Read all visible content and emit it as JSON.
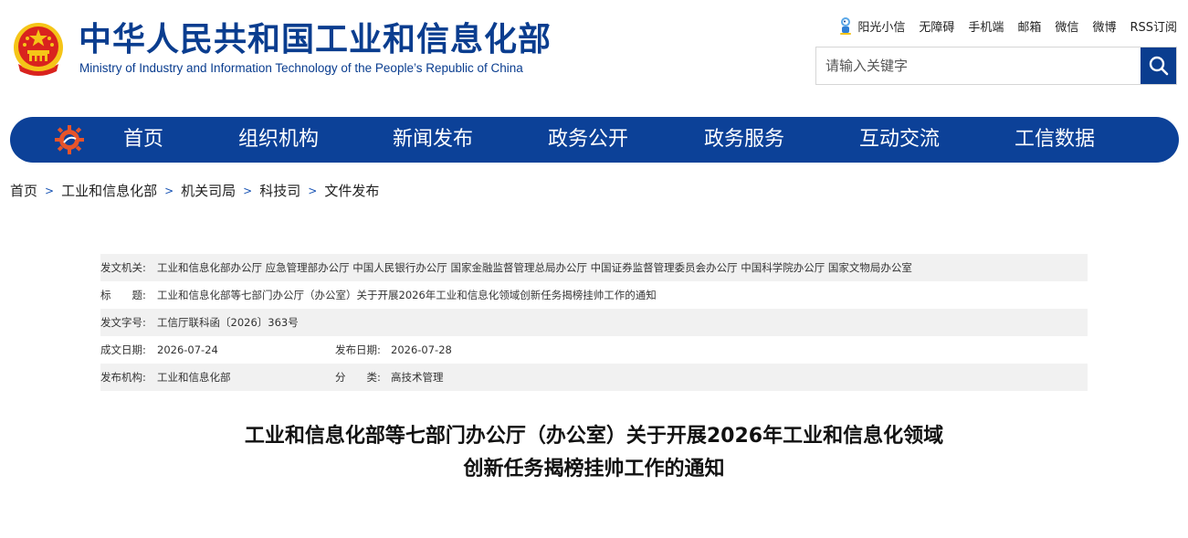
{
  "header": {
    "title_cn": "中华人民共和国工业和信息化部",
    "title_en": "Ministry of Industry and Information Technology of the People’s Republic of China",
    "links": [
      {
        "label": "阳光小信",
        "icon": "mascot-icon"
      },
      {
        "label": "无障碍"
      },
      {
        "label": "手机端"
      },
      {
        "label": "邮箱"
      },
      {
        "label": "微信"
      },
      {
        "label": "微博"
      },
      {
        "label": "RSS订阅"
      }
    ],
    "search": {
      "placeholder": "请输入关键字",
      "value": ""
    }
  },
  "nav": {
    "items": [
      "首页",
      "组织机构",
      "新闻发布",
      "政务公开",
      "政务服务",
      "互动交流",
      "工信数据"
    ]
  },
  "breadcrumb": [
    "首页",
    "工业和信息化部",
    "机关司局",
    "科技司",
    "文件发布"
  ],
  "info": {
    "issuer_label": "发文机关:",
    "issuer_value": "工业和信息化部办公厅 应急管理部办公厅 中国人民银行办公厅 国家金融监督管理总局办公厅 中国证券监督管理委员会办公厅 中国科学院办公厅 国家文物局办公室",
    "title_label": "标　　题:",
    "title_value": "工业和信息化部等七部门办公厅（办公室）关于开展2026年工业和信息化领域创新任务揭榜挂帅工作的通知",
    "docno_label": "发文字号:",
    "docno_value": "工信厅联科函〔2026〕363号",
    "created_label": "成文日期:",
    "created_value": "2026-07-24",
    "published_label": "发布日期:",
    "published_value": "2026-07-28",
    "agency_label": "发布机构:",
    "agency_value": "工业和信息化部",
    "category_label": "分　　类:",
    "category_value": "高技术管理"
  },
  "article": {
    "title_line1": "工业和信息化部等七部门办公厅（办公室）关于开展2026年工业和信息化领域",
    "title_line2": "创新任务揭榜挂帅工作的通知"
  },
  "colors": {
    "brand_blue": "#0a3d8f",
    "nav_blue": "#0c4198",
    "emblem_red": "#d9231e",
    "emblem_gold": "#f5c518"
  }
}
